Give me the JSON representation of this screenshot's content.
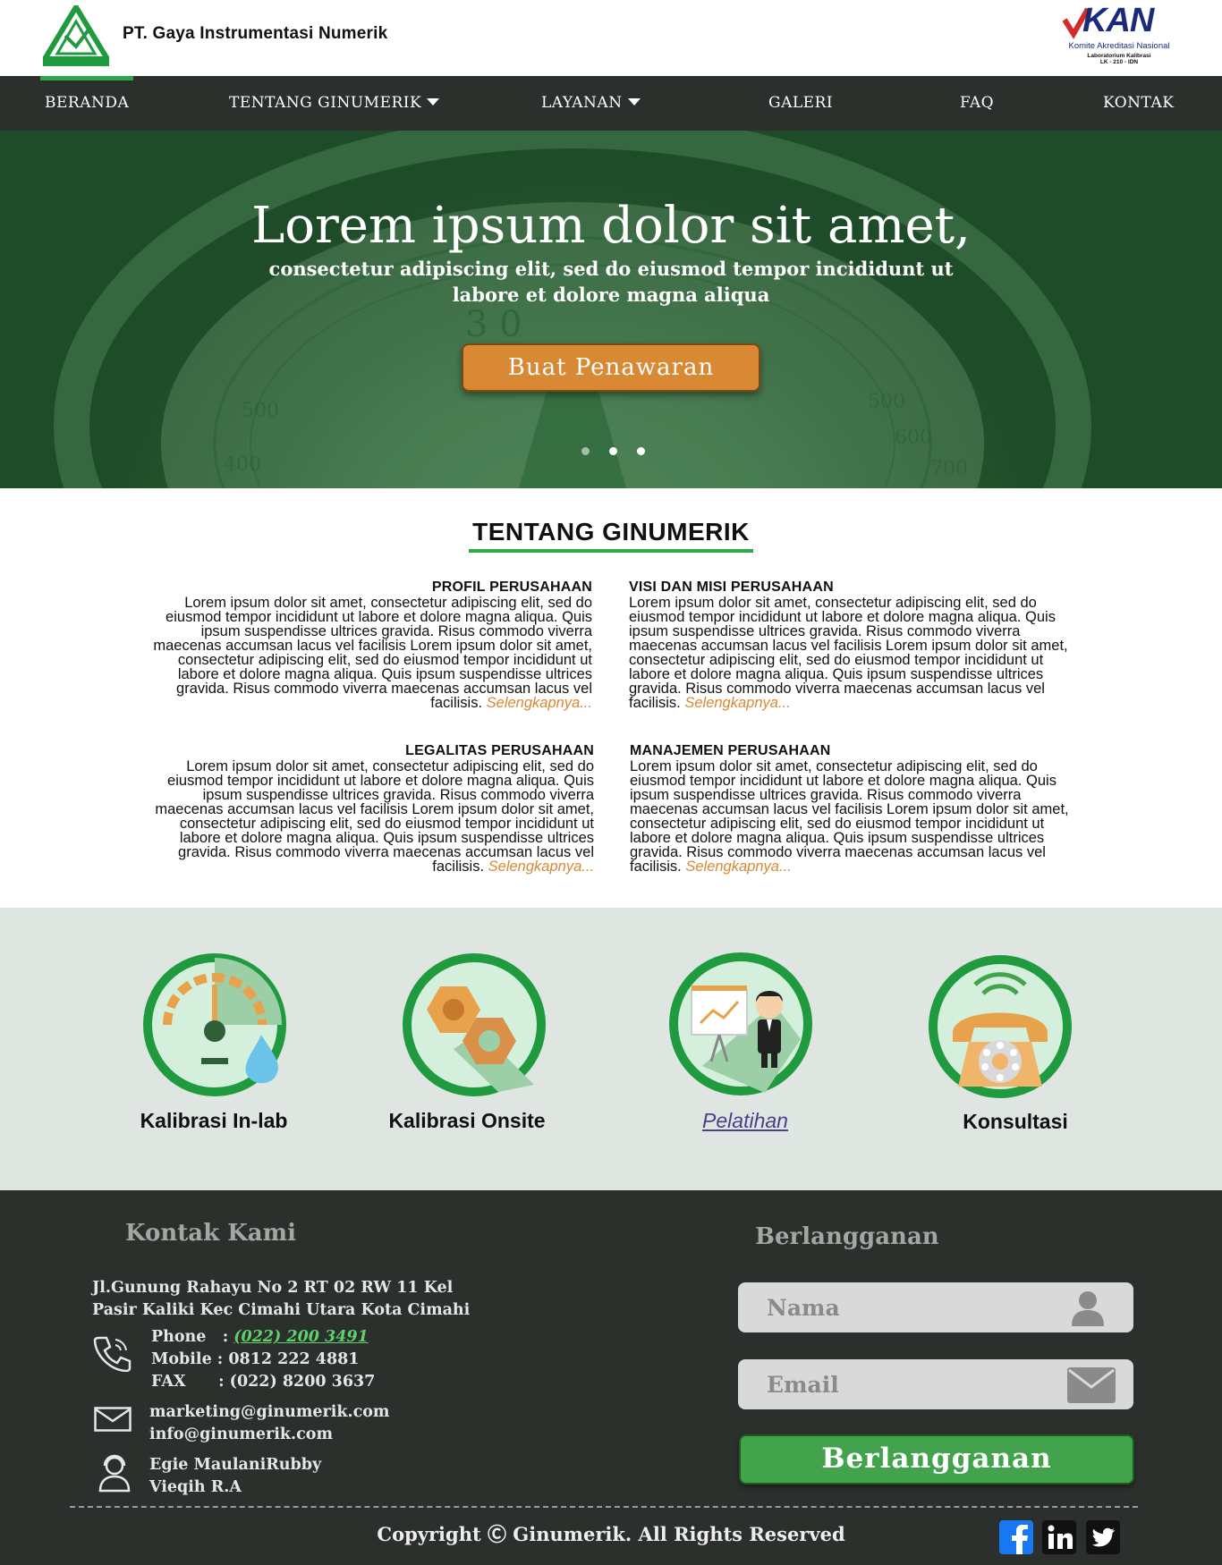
{
  "header": {
    "company_name": "PT. Gaya Instrumentasi Numerik",
    "kan_logo_text": "KAN",
    "kan_subtitle": "Komite Akreditasi Nasional",
    "kan_lab": "Laboratorium Kalibrasi",
    "kan_code": "LK - 210 - IDN"
  },
  "nav": {
    "items": [
      {
        "label": "BERANDA",
        "active": true
      },
      {
        "label": "TENTANG GINUMERIK",
        "dropdown": true
      },
      {
        "label": "LAYANAN",
        "dropdown": true
      },
      {
        "label": "GALERI"
      },
      {
        "label": "FAQ"
      },
      {
        "label": "KONTAK"
      }
    ],
    "accent_color": "#2fa64c"
  },
  "hero": {
    "title": "Lorem ipsum dolor sit amet,",
    "subtitle": "consectetur adipiscing elit, sed do eiusmod tempor incididunt ut labore et dolore magna aliqua",
    "button_label": "Buat Penawaran",
    "button_color": "#d98833",
    "slides_count": 3,
    "active_slide": 2
  },
  "about": {
    "title": "TENTANG GINUMERIK",
    "more_label": "Selengkapnya...",
    "sections": [
      {
        "heading": "PROFIL PERUSAHAAN",
        "body": "Lorem ipsum dolor sit amet, consectetur adipiscing elit, sed do eiusmod tempor incididunt ut labore et dolore magna aliqua. Quis ipsum suspendisse ultrices gravida. Risus commodo viverra maecenas accumsan lacus vel facilisis Lorem ipsum dolor sit amet, consectetur adipiscing elit, sed do eiusmod tempor incididunt ut labore et dolore magna aliqua. Quis ipsum suspendisse ultrices gravida. Risus commodo viverra maecenas accumsan lacus vel facilisis."
      },
      {
        "heading": "VISI DAN MISI PERUSAHAAN",
        "body": "Lorem ipsum dolor sit amet, consectetur adipiscing elit, sed do eiusmod tempor incididunt ut labore et dolore magna aliqua. Quis ipsum suspendisse ultrices gravida. Risus commodo viverra maecenas accumsan lacus vel facilisis Lorem ipsum dolor sit amet, consectetur adipiscing elit, sed do eiusmod tempor incididunt ut labore et dolore magna aliqua. Quis ipsum suspendisse ultrices gravida. Risus commodo viverra maecenas accumsan lacus vel facilisis."
      },
      {
        "heading": "LEGALITAS PERUSAHAAN",
        "body": "Lorem ipsum dolor sit amet, consectetur adipiscing elit, sed do eiusmod tempor incididunt ut labore et dolore magna aliqua. Quis ipsum suspendisse ultrices gravida. Risus commodo viverra maecenas accumsan lacus vel facilisis Lorem ipsum dolor sit amet, consectetur adipiscing elit, sed do eiusmod tempor incididunt ut labore et dolore magna aliqua. Quis ipsum suspendisse ultrices gravida. Risus commodo viverra maecenas accumsan lacus vel facilisis."
      },
      {
        "heading": "MANAJEMEN PERUSAHAAN",
        "body": "Lorem ipsum dolor sit amet, consectetur adipiscing elit, sed do eiusmod tempor incididunt ut labore et dolore magna aliqua. Quis ipsum suspendisse ultrices gravida. Risus commodo viverra maecenas accumsan lacus vel facilisis Lorem ipsum dolor sit amet, consectetur adipiscing elit, sed do eiusmod tempor incididunt ut labore et dolore magna aliqua. Quis ipsum suspendisse ultrices gravida. Risus commodo viverra maecenas accumsan lacus vel facilisis."
      }
    ]
  },
  "services": {
    "items": [
      {
        "label": "Kalibrasi In-lab",
        "icon": "gauge-droplet-icon"
      },
      {
        "label": "Kalibrasi Onsite",
        "icon": "hex-nuts-icon"
      },
      {
        "label": "Pelatihan",
        "icon": "presenter-icon",
        "link": true
      },
      {
        "label": "Konsultasi",
        "icon": "telephone-icon"
      }
    ]
  },
  "footer": {
    "contact_heading": "Kontak Kami",
    "address_line1": "Jl.Gunung Rahayu No 2 RT 02 RW 11 Kel",
    "address_line2": "Pasir Kaliki Kec Cimahi Utara Kota Cimahi",
    "phone_label": "Phone   :",
    "phone_value": "(022) 200 3491",
    "mobile": "Mobile : 0812 222 4881",
    "fax": "FAX      : (022) 8200 3637",
    "email1": "marketing@ginumerik.com",
    "email2": "info@ginumerik.com",
    "person1": "Egie MaulaniRubby",
    "person2": "Vieqih R.A",
    "subscribe_heading": "Berlangganan",
    "name_placeholder": "Nama",
    "email_placeholder": "Email",
    "subscribe_button": "Berlangganan",
    "copyright": "Copyright Ⓒ Ginumerik. All Rights Reserved",
    "social": [
      "facebook-icon",
      "linkedin-icon",
      "twitter-icon"
    ]
  }
}
